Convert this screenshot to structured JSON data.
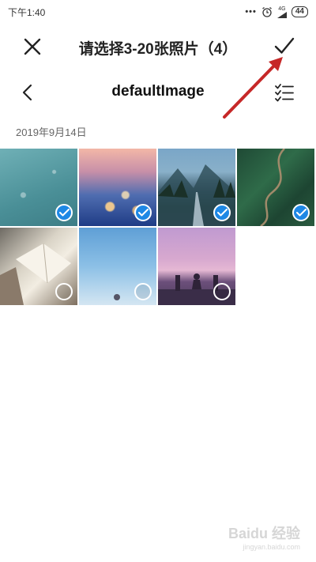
{
  "status": {
    "time": "下午1:40",
    "net": "4G",
    "battery": "44"
  },
  "header": {
    "title": "请选择3-20张照片（4）"
  },
  "album": {
    "name": "defaultImage"
  },
  "date_group": "2019年9月14日",
  "photos": [
    {
      "selected": true
    },
    {
      "selected": true
    },
    {
      "selected": true
    },
    {
      "selected": true
    },
    {
      "selected": false
    },
    {
      "selected": false
    },
    {
      "selected": false
    }
  ],
  "watermark": {
    "text": "Baidu 经验",
    "sub": "jingyan.baidu.com"
  },
  "colors": {
    "accent": "#1e88e5",
    "annotation_arrow": "#c62828"
  }
}
